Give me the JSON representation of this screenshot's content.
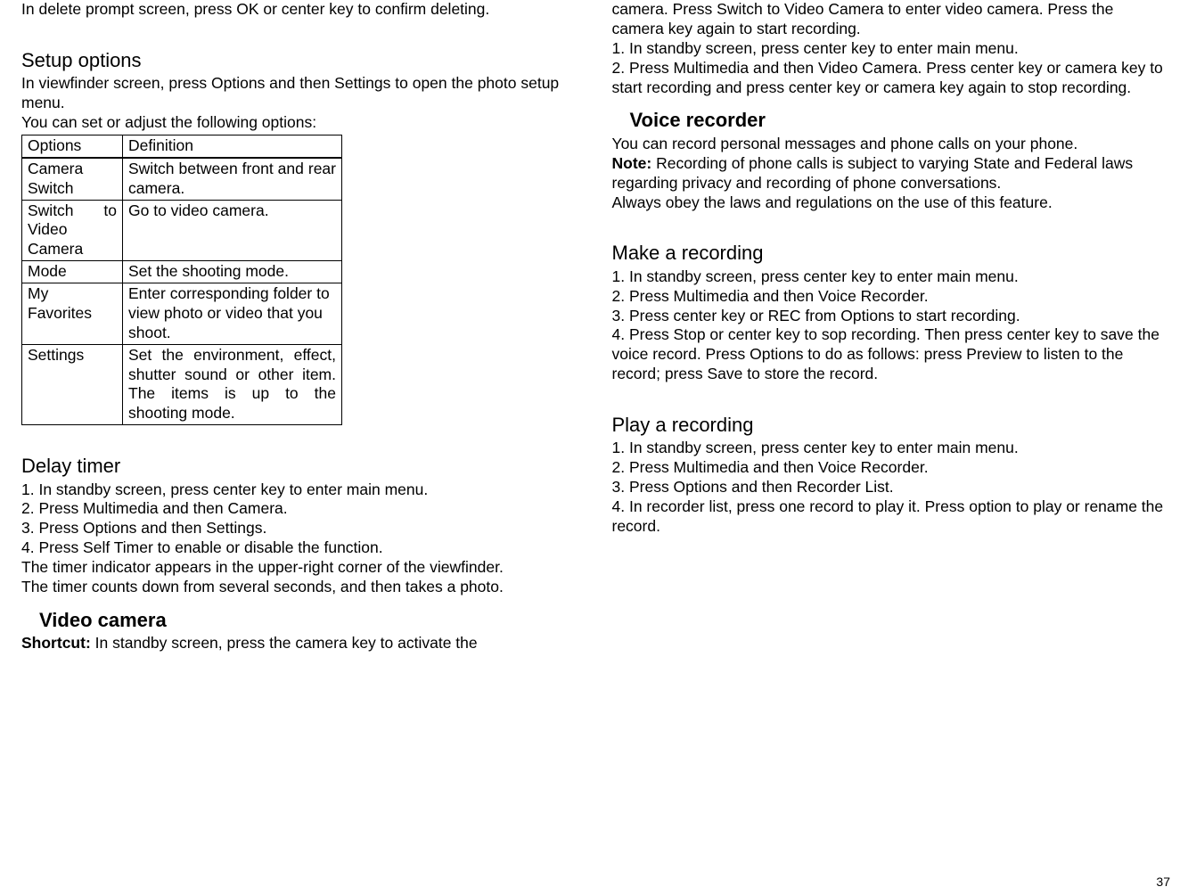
{
  "left": {
    "topLine": "In delete prompt screen, press OK or center key to confirm deleting.",
    "setupHeading": "Setup options",
    "setupIntro1": "In viewfinder screen, press Options and then Settings to open the photo setup menu.",
    "setupIntro2": "You can set or adjust the following options:",
    "table": {
      "head": {
        "opt": "Options",
        "def": "Definition"
      },
      "rows": [
        {
          "opt": "Camera Switch",
          "def": "Switch between front and rear camera."
        },
        {
          "opt": "Switch to Video Camera",
          "def": "Go to video camera."
        },
        {
          "opt": "Mode",
          "def": "Set the shooting mode."
        },
        {
          "opt": "My Favorites",
          "def": "Enter corresponding folder to view photo or video that you shoot."
        },
        {
          "opt": "Settings",
          "def": "Set the environment, effect, shutter sound or other item. The items is up to the shooting mode."
        }
      ]
    },
    "delayHeading": "Delay timer",
    "delay": [
      "1. In standby screen, press center key to enter main menu.",
      "2. Press Multimedia and then Camera.",
      "3. Press Options and then Settings.",
      "4. Press Self Timer to enable or disable the function.",
      "The timer indicator appears in the upper-right corner of the viewfinder.",
      "The timer counts down from several seconds, and then takes a photo."
    ],
    "videoHeading": "Video camera",
    "videoShortcutLabel": "Shortcut:",
    "videoShortcutText": " In standby screen, press the camera key to activate the"
  },
  "right": {
    "topLines": [
      "camera. Press Switch to Video Camera to enter video camera. Press the camera key again to start recording.",
      "1. In standby screen, press center key to enter main menu.",
      "2. Press Multimedia and then Video Camera. Press center key or camera key to start recording and press center key or camera key again to stop recording."
    ],
    "voiceHeading": "Voice recorder",
    "voiceIntro": "You can record personal messages and phone calls on your phone.",
    "voiceNoteLabel": "Note:",
    "voiceNoteText": " Recording of phone calls is subject to varying State and Federal laws regarding privacy and recording of phone conversations.",
    "voiceObey": "Always obey the laws and regulations on the use of this feature.",
    "makeHeading": "Make a recording",
    "make": [
      "1. In standby screen, press center key to enter main menu.",
      "2. Press Multimedia and then Voice Recorder.",
      "3. Press center key or REC from Options to start recording.",
      "4. Press Stop or center key to sop recording. Then press center key to save the voice record. Press Options to do as follows: press Preview to listen to the record; press Save to store the record."
    ],
    "playHeading": "Play a recording",
    "play": [
      "1. In standby screen, press center key to enter main menu.",
      "2. Press Multimedia and then Voice Recorder.",
      "3. Press Options and then Recorder List.",
      "4. In recorder list, press one record to play it. Press option to play or rename the record."
    ]
  },
  "pageNumber": "37"
}
